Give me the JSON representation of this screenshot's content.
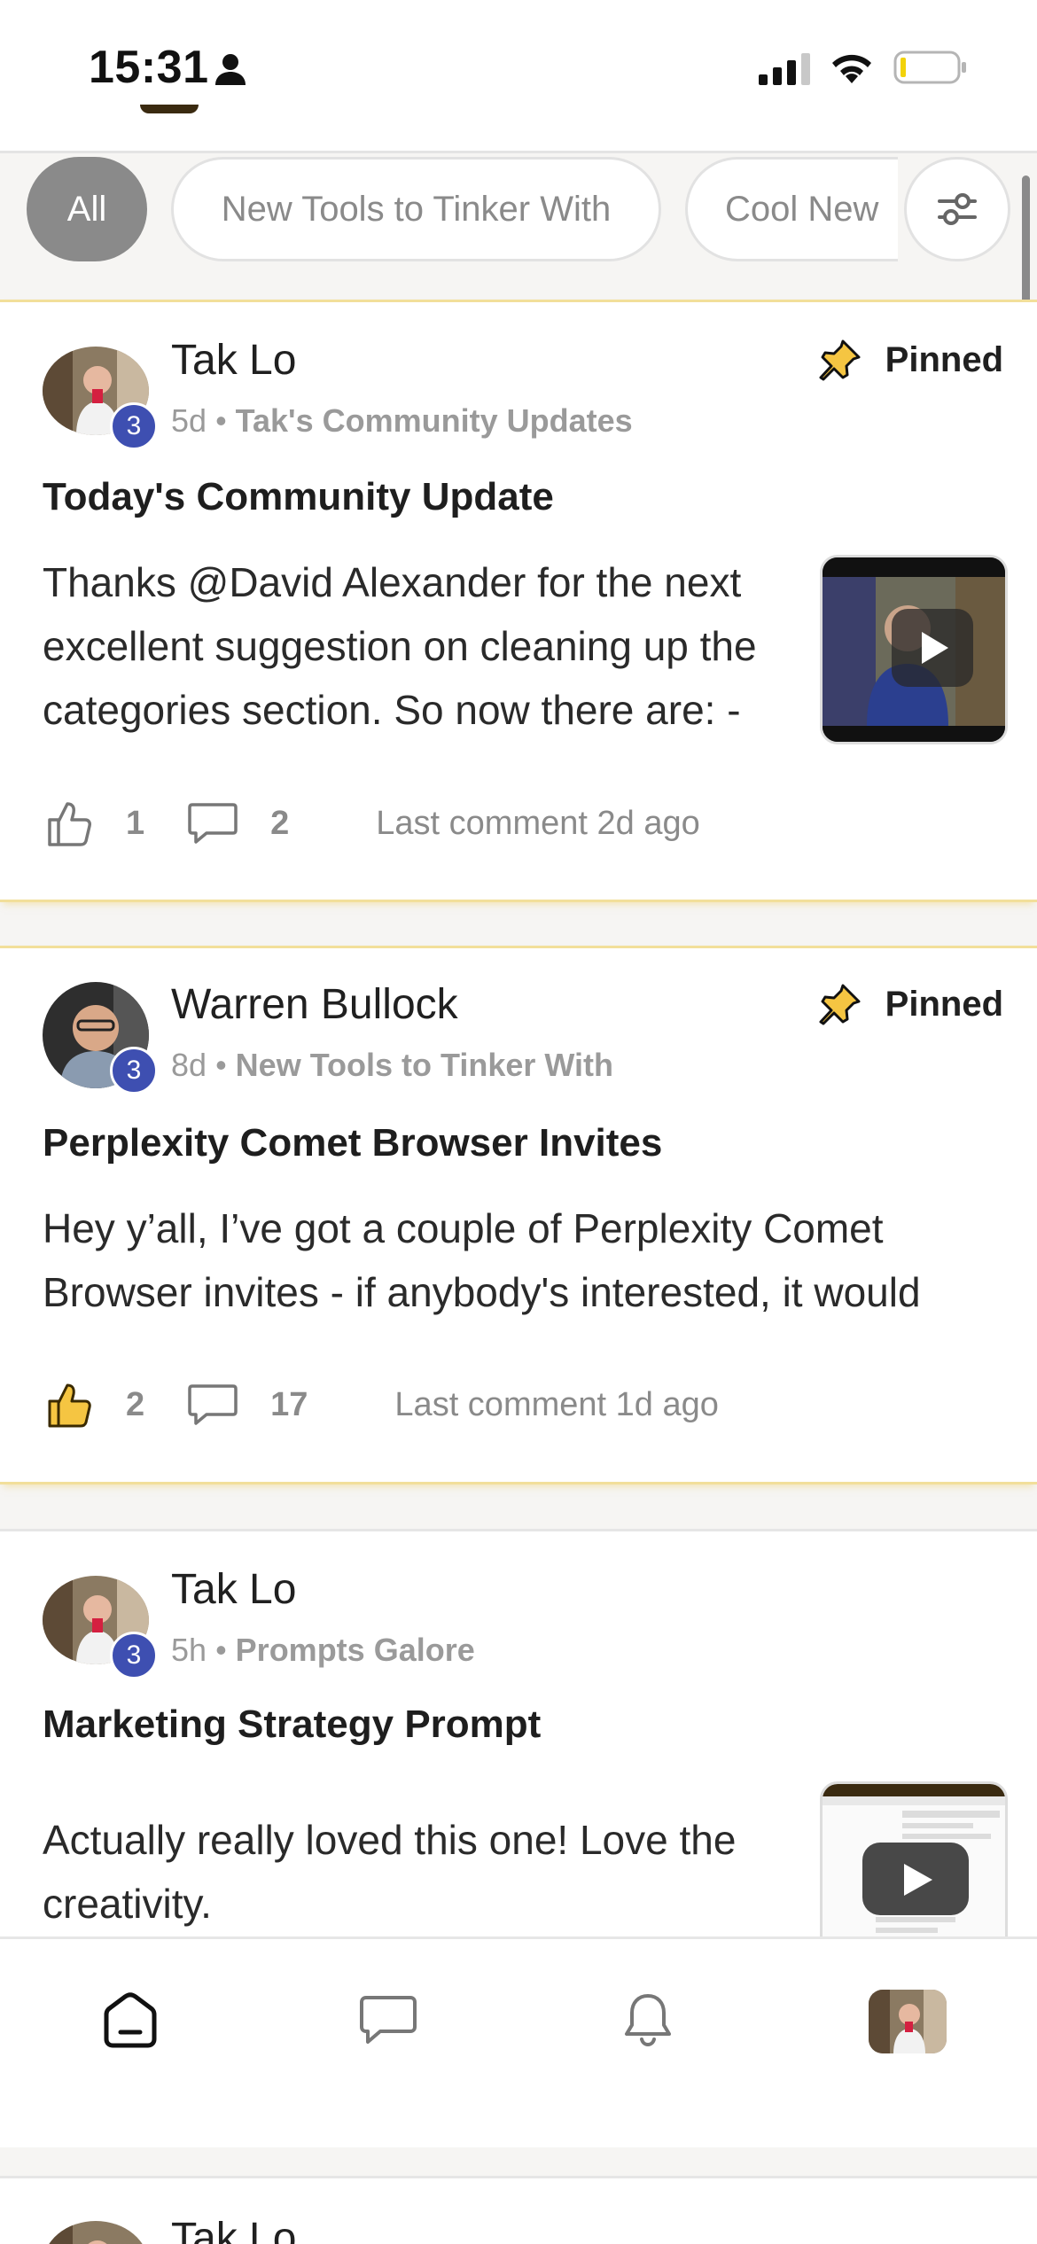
{
  "status": {
    "time": "15:31"
  },
  "filters": {
    "chips": [
      "All",
      "New Tools to Tinker With",
      "Cool New"
    ],
    "icon": "sliders-icon"
  },
  "posts": [
    {
      "author": "Tak Lo",
      "level": "3",
      "age": "5d",
      "category": "Tak's Community Updates",
      "pinned": "Pinned",
      "title": "Today's Community Update",
      "body": "Thanks @David Alexander for the next excellent suggestion on cleaning up the categories section. So now there are: -",
      "likes": "1",
      "comments": "2",
      "last_comment": "Last comment 2d ago"
    },
    {
      "author": "Warren Bullock",
      "level": "3",
      "age": "8d",
      "category": "New Tools to Tinker With",
      "pinned": "Pinned",
      "title": "Perplexity Comet Browser Invites",
      "body": "Hey y’all, I’ve got a couple of Perplexity Comet Browser invites - if anybody's interested, it would",
      "likes": "2",
      "comments": "17",
      "last_comment": "Last comment 1d ago"
    },
    {
      "author": "Tak Lo",
      "level": "3",
      "age": "5h",
      "category": "Prompts Galore",
      "title": "Marketing Strategy Prompt",
      "body": "Actually really loved this one! Love the creativity."
    },
    {
      "author": "Tak Lo"
    }
  ],
  "colors": {
    "accent_pin_border": "#f2df9a",
    "level_badge": "#3e4fb1",
    "like_active": "#f5c542"
  },
  "nav": [
    "home-icon",
    "chat-icon",
    "bell-icon",
    "profile-avatar"
  ]
}
